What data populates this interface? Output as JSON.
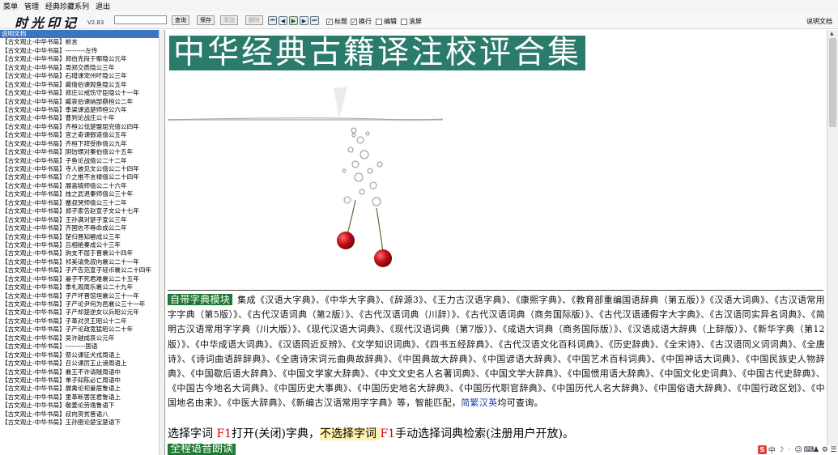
{
  "menu": [
    "菜单",
    "管理",
    "经典珍藏系列",
    "退出"
  ],
  "app": {
    "logo": "时光印记",
    "version": "V2.83"
  },
  "toolbar": {
    "search_placeholder": "",
    "query_label": "查询",
    "save_label": "保存",
    "add_label": "添加",
    "delete_label": "删除",
    "checks": [
      {
        "label": "标题",
        "checked": true
      },
      {
        "label": "换行",
        "checked": true
      },
      {
        "label": "编辑",
        "checked": false
      },
      {
        "label": "滚屏",
        "checked": false
      }
    ],
    "help_label": "说明文档"
  },
  "sidebar": {
    "items": [
      "说明文档",
      "【古文观止-中华书局】前言",
      "【古文观止-中华书局】---------左传",
      "【古文观止-中华书局】郑伯克段于鄢隐公元年",
      "【古文观止-中华书局】周郑交质隐公三年",
      "【古文观止-中华书局】石碏谏宠州吁隐公三年",
      "【古文观止-中华书局】臧僖伯谏观鱼隐公五年",
      "【古文观止-中华书局】郑庄公戒饬守臣隐公十一年",
      "【古文观止-中华书局】臧哀伯谏纳郜鼎桓公二年",
      "【古文观止-中华书局】季梁谏追楚师桓公六年",
      "【古文观止-中华书局】曹刿论战庄公十年",
      "【古文观止-中华书局】齐桓公伐楚盟屈完僖公四年",
      "【古文观止-中华书局】宫之奇谏假道僖公五年",
      "【古文观止-中华书局】齐桓下拜受胙僖公九年",
      "【古文观止-中华书局】阴饴甥对秦伯僖公十五年",
      "【古文观止-中华书局】子鱼论战僖公二十二年",
      "【古文观止-中华书局】寺人披见文公僖公二十四年",
      "【古文观止-中华书局】介之推不言禄僖公二十四年",
      "【古文观止-中华书局】展喜犒师僖公二十六年",
      "【古文观止-中华书局】烛之武退秦师僖公三十年",
      "【古文观止-中华书局】蹇叔哭师僖公三十二年",
      "【古文观止-中华书局】郑子家告赵宣子文公十七年",
      "【古文观止-中华书局】王孙满对楚子宣公三年",
      "【古文观止-中华书局】齐国佐不辱命成公二年",
      "【古文观止-中华书局】楚归晋知罃成公三年",
      "【古文观止-中华书局】吕相绝秦成公十三年",
      "【古文观止-中华书局】驹支不屈于晋襄公十四年",
      "【古文观止-中华书局】祁奚请免叔向襄公二十一年",
      "【古文观止-中华书局】子产告范宣子轻币襄公二十四年",
      "【古文观止-中华书局】晏子不死君难襄公二十五年",
      "【古文观止-中华书局】季札观周乐襄公二十九年",
      "【古文观止-中华书局】子产坏晋馆垣襄公三十一年",
      "【古文观止-中华书局】子产论尹何为邑襄公三十一年",
      "【古文观止-中华书局】子产却楚逆女以兵昭公元年",
      "【古文观止-中华书局】子革对灵王昭公十二年",
      "【古文观止-中华书局】子产论政宽猛昭公二十年",
      "【古文观止-中华书局】吴许越成哀公元年",
      "【古文观止-中华书局】---------国语",
      "【古文观止-中华书局】祭公谏征犬戎周语上",
      "【古文观止-中华书局】召公谏厉王止谤周语上",
      "【古文观止-中华书局】襄王不许请隧周语中",
      "【古文观止-中华书局】单子知陈必亡周语中",
      "【古文观止-中华书局】展禽论祀爰居鲁语上",
      "【古文观止-中华书局】里革断罟匡君鲁语上",
      "【古文观止-中华书局】敬姜论劳逸鲁语下",
      "【古文观止-中华书局】叔向贺贫晋语八",
      "【古文观止-中华书局】王孙圉论楚宝楚语下"
    ]
  },
  "content": {
    "banner_title": "中华经典古籍译注校评合集",
    "dict_tag": "自带字典模块",
    "dict_text": "集成《汉语大字典》、《中华大字典》、《辞源3》、《王力古汉语字典》、《康熙字典》、《教育部重编国语辞典（第五版）》《汉语大词典》、《古汉语常用字字典（第5版）》、《古代汉语词典（第2版）》、《古代汉语词典（川辞）》、《古代汉语词典（商务国际版）》、《古代汉语通假字大字典》、《古汉语同实异名词典》、《简明古汉语常用字字典（川大版）》、《现代汉语大词典》、《现代汉语词典（第7版）》、《成语大词典（商务国际版）》、《汉语成语大辞典（上辞版）》、《新华字典（第12版）》、《中华成语大词典》、《汉语同近反辨》、《文学知识词典》、《四书五经辞典》、《古代汉语文化百科词典》、《历史辞典》、《全宋诗》、《古汉语同义词词典》、《全唐诗》、《诗词曲语辞辞典》、《全唐诗宋词元曲典故辞典》、《中国典故大辞典》、《中国谚语大辞典》、《中国艺术百科词典》、《中国神话大词典》、《中国民族史人物辞典》、《中国歇后语大辞典》、《中国文学家大辞典》、《中文文史名人名著词典》、《中国文学大辞典》、《中国惯用语大辞典》、《中国文化史词典》、《中国古代史辞典》、《中国古今地名大词典》、《中国历史大事典》、《中国历史地名大辞典》、《中国历代职官辞典》、《中国历代人名大辞典》、《中国俗语大辞典》、《中国行政区划》、《中国地名由来》、《中医大辞典》、《新编古汉语常用字字典》等，智能匹配，",
    "dict_link": "简繁汉英",
    "dict_tail": "均可查询。",
    "f1_a": "选择字词 ",
    "f1_key1": "F1",
    "f1_b": "打开(关闭)字典，",
    "f1_c": "不选择字词 ",
    "f1_key2": "F1",
    "f1_d": "手动选择词典检索(注册用户开放)。",
    "reading_tag": "全程语音朗读"
  },
  "ime": {
    "logo": "S",
    "glyphs": [
      "中",
      "☽",
      "·",
      "☺",
      "⌨",
      "♟",
      "⚙",
      "☰"
    ]
  },
  "colors": {
    "banner": "#2b7b6c",
    "tag": "#1f7a33",
    "selection": "#3c74c6",
    "f1": "#dd0000"
  }
}
